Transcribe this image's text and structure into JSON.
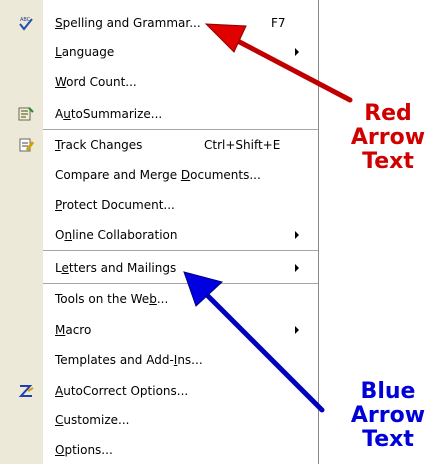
{
  "menu": {
    "items": [
      {
        "pre": "",
        "u": "S",
        "post": "pelling and Grammar...",
        "shortcut": "F7",
        "submenu": false,
        "icon": "spelling-icon"
      },
      {
        "pre": "",
        "u": "L",
        "post": "anguage",
        "shortcut": "",
        "submenu": true,
        "icon": ""
      },
      {
        "pre": "",
        "u": "W",
        "post": "ord Count...",
        "shortcut": "",
        "submenu": false,
        "icon": ""
      },
      {
        "pre": "A",
        "u": "u",
        "post": "toSummarize...",
        "shortcut": "",
        "submenu": false,
        "icon": "autosummarize-icon"
      },
      {
        "pre": "",
        "u": "T",
        "post": "rack Changes",
        "shortcut": "Ctrl+Shift+E",
        "submenu": false,
        "icon": "track-changes-icon"
      },
      {
        "pre": "Compare and Merge ",
        "u": "D",
        "post": "ocuments...",
        "shortcut": "",
        "submenu": false,
        "icon": ""
      },
      {
        "pre": "",
        "u": "P",
        "post": "rotect Document...",
        "shortcut": "",
        "submenu": false,
        "icon": ""
      },
      {
        "pre": "O",
        "u": "n",
        "post": "line Collaboration",
        "shortcut": "",
        "submenu": true,
        "icon": ""
      },
      {
        "pre": "L",
        "u": "e",
        "post": "tters and Mailings",
        "shortcut": "",
        "submenu": true,
        "icon": ""
      },
      {
        "pre": "Tools on the We",
        "u": "b",
        "post": "...",
        "shortcut": "",
        "submenu": false,
        "icon": ""
      },
      {
        "pre": "",
        "u": "M",
        "post": "acro",
        "shortcut": "",
        "submenu": true,
        "icon": ""
      },
      {
        "pre": "Templates and Add-",
        "u": "I",
        "post": "ns...",
        "shortcut": "",
        "submenu": false,
        "icon": ""
      },
      {
        "pre": "",
        "u": "A",
        "post": "utoCorrect Options...",
        "shortcut": "",
        "submenu": false,
        "icon": "autocorrect-icon"
      },
      {
        "pre": "",
        "u": "C",
        "post": "ustomize...",
        "shortcut": "",
        "submenu": false,
        "icon": ""
      },
      {
        "pre": "",
        "u": "O",
        "post": "ptions...",
        "shortcut": "",
        "submenu": false,
        "icon": ""
      }
    ]
  },
  "annotations": {
    "red_line1": "Red",
    "red_line2": "Arrow",
    "red_line3": "Text",
    "blue_line1": "Blue",
    "blue_line2": "Arrow",
    "blue_line3": "Text"
  },
  "colors": {
    "red_arrow": "#e00000",
    "blue_arrow": "#0000e0",
    "gutter": "#ece9d8"
  }
}
